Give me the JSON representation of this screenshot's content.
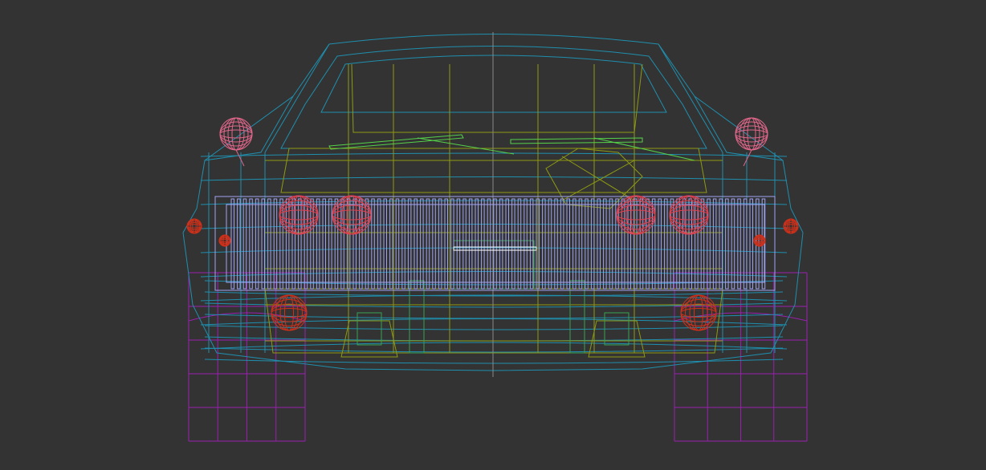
{
  "viewport": {
    "background": "#333333",
    "render_mode": "wireframe"
  },
  "colors": {
    "body": "#1f8fae",
    "interior": "#8f9a12",
    "grille": "#9fa3f0",
    "lights": "#d0301a",
    "indicators": "#e04050",
    "wheels": "#9a1fb0",
    "wipers": "#55d24a",
    "mirrors": "#e0668a",
    "frame": "#3aa050"
  }
}
